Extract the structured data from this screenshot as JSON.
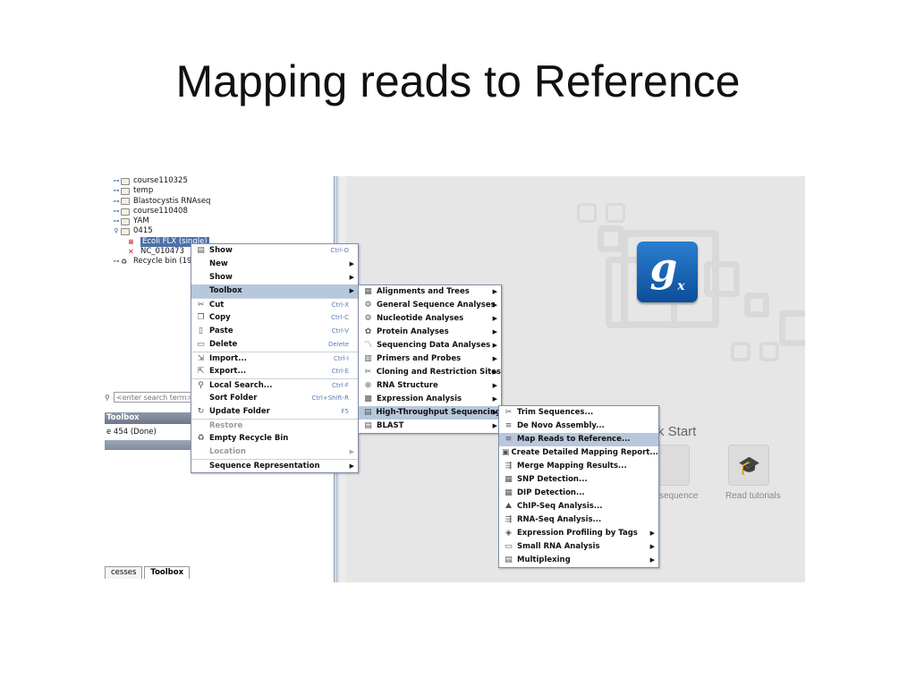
{
  "slide": {
    "title": "Mapping reads to Reference"
  },
  "tree": {
    "items": [
      {
        "label": "course110325",
        "type": "folder",
        "expanded": false
      },
      {
        "label": "temp",
        "type": "folder",
        "expanded": false
      },
      {
        "label": "Blastocystis RNAseq",
        "type": "folder",
        "expanded": false
      },
      {
        "label": "course110408",
        "type": "folder",
        "expanded": false
      },
      {
        "label": "YAM",
        "type": "folder",
        "expanded": false
      },
      {
        "label": "0415",
        "type": "folder",
        "expanded": true
      }
    ],
    "children": [
      {
        "label": "Ecoli FLX (single)",
        "selected": true
      },
      {
        "label": "NC_010473"
      }
    ],
    "recycle": "Recycle bin (19"
  },
  "search": {
    "placeholder": "<enter search term>"
  },
  "toolbox_header": "Toolbox",
  "process": "e 454 (Done)",
  "bottom_tabs": [
    "cesses",
    "Toolbox"
  ],
  "quick_start": {
    "title": "k Start",
    "tiles": [
      {
        "label": "sequence"
      },
      {
        "label": "Read tutorials"
      }
    ]
  },
  "menu_main": {
    "items": [
      {
        "label": "Show",
        "shortcut": "Ctrl-O",
        "icon": "show-icon"
      },
      {
        "label": "New",
        "submenu": true
      },
      {
        "label": "Show",
        "submenu": true
      },
      {
        "label": "Toolbox",
        "submenu": true,
        "highlighted": true
      },
      {
        "label": "Cut",
        "shortcut": "Ctrl-X",
        "icon": "cut-icon",
        "sep_before": true
      },
      {
        "label": "Copy",
        "shortcut": "Ctrl-C",
        "icon": "copy-icon"
      },
      {
        "label": "Paste",
        "shortcut": "Ctrl-V",
        "icon": "paste-icon"
      },
      {
        "label": "Delete",
        "shortcut": "Delete",
        "icon": "delete-icon"
      },
      {
        "label": "Import...",
        "shortcut": "Ctrl-I",
        "icon": "import-icon",
        "sep_before": true
      },
      {
        "label": "Export...",
        "shortcut": "Ctrl-E",
        "icon": "export-icon"
      },
      {
        "label": "Local Search...",
        "shortcut": "Ctrl-F",
        "icon": "search-icon",
        "sep_before": true
      },
      {
        "label": "Sort Folder",
        "shortcut": "Ctrl+Shift-R"
      },
      {
        "label": "Update Folder",
        "shortcut": "F5",
        "icon": "refresh-icon"
      },
      {
        "label": "Restore",
        "disabled": true,
        "sep_before": true
      },
      {
        "label": "Empty Recycle Bin",
        "icon": "recycle-icon"
      },
      {
        "label": "Location",
        "disabled": true,
        "submenu": true
      },
      {
        "label": "Sequence Representation",
        "submenu": true,
        "sep_before": true
      }
    ]
  },
  "menu_toolbox": {
    "items": [
      {
        "label": "Alignments and Trees"
      },
      {
        "label": "General Sequence Analyses"
      },
      {
        "label": "Nucleotide Analyses"
      },
      {
        "label": "Protein Analyses"
      },
      {
        "label": "Sequencing Data Analyses"
      },
      {
        "label": "Primers and Probes"
      },
      {
        "label": "Cloning and Restriction Sites"
      },
      {
        "label": "RNA Structure"
      },
      {
        "label": "Expression Analysis"
      },
      {
        "label": "High-Throughput Sequencing",
        "highlighted": true
      },
      {
        "label": "BLAST"
      }
    ]
  },
  "menu_hts": {
    "items": [
      {
        "label": "Trim Sequences..."
      },
      {
        "label": "De Novo Assembly..."
      },
      {
        "label": "Map Reads to Reference...",
        "highlighted": true
      },
      {
        "label": "Create Detailed Mapping Report..."
      },
      {
        "label": "Merge Mapping Results..."
      },
      {
        "label": "SNP Detection..."
      },
      {
        "label": "DIP Detection..."
      },
      {
        "label": "ChIP-Seq Analysis..."
      },
      {
        "label": "RNA-Seq Analysis..."
      },
      {
        "label": "Expression Profiling by Tags",
        "submenu": true
      },
      {
        "label": "Small RNA Analysis",
        "submenu": true
      },
      {
        "label": "Multiplexing",
        "submenu": true
      }
    ]
  },
  "colors": {
    "highlight": "#b7c7dc",
    "selection": "#4d71a8",
    "logo": "#1566b8"
  }
}
